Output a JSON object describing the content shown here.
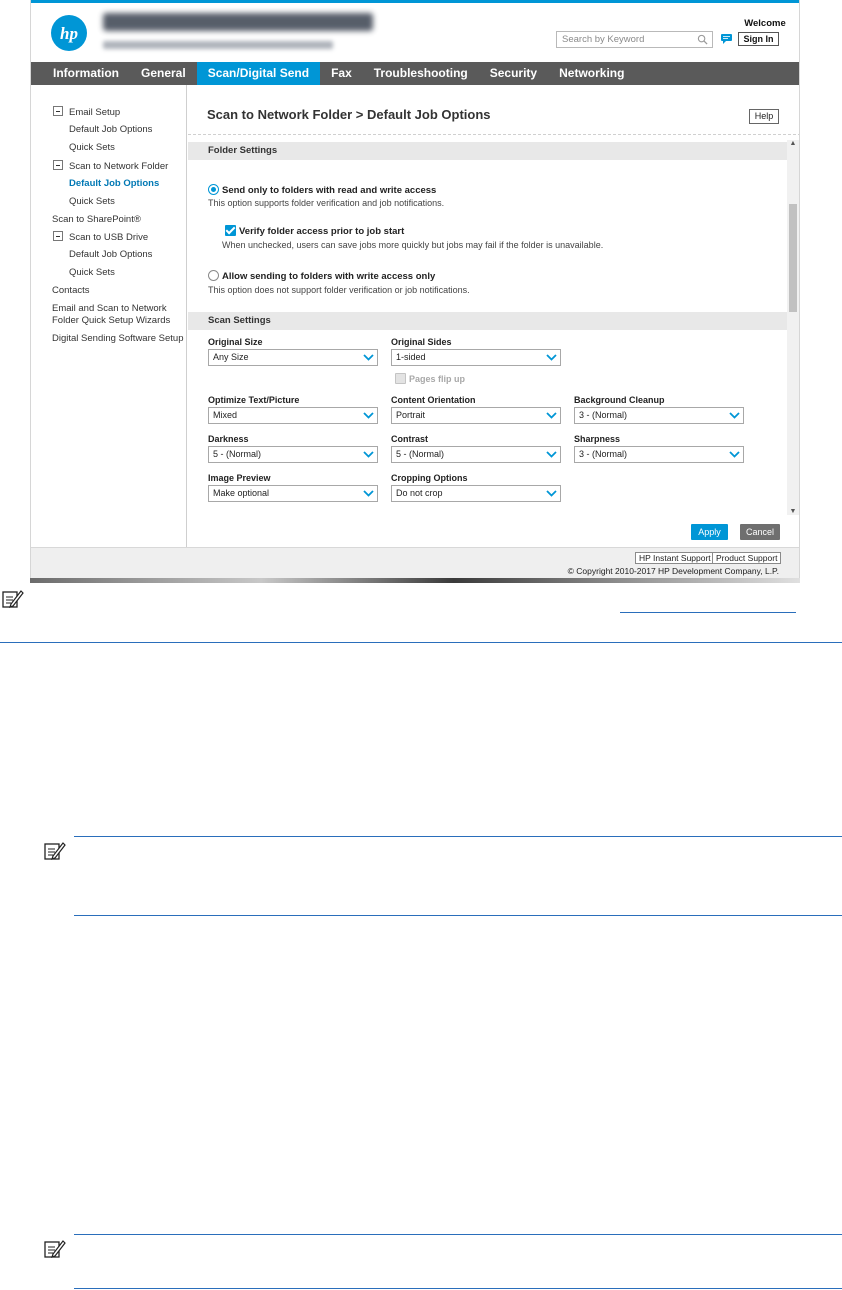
{
  "header": {
    "welcome": "Welcome",
    "sign_in": "Sign In",
    "search_placeholder": "Search by Keyword"
  },
  "nav": {
    "items": [
      "Information",
      "General",
      "Scan/Digital Send",
      "Fax",
      "Troubleshooting",
      "Security",
      "Networking"
    ],
    "active": "Scan/Digital Send"
  },
  "sidebar": {
    "email_setup": "Email Setup",
    "email_default_job_options": "Default Job Options",
    "email_quick_sets": "Quick Sets",
    "scan_to_network_folder": "Scan to Network Folder",
    "snf_default_job_options": "Default Job Options",
    "snf_quick_sets": "Quick Sets",
    "scan_to_sharepoint": "Scan to SharePoint®",
    "scan_to_usb_drive": "Scan to USB Drive",
    "usb_default_job_options": "Default Job Options",
    "usb_quick_sets": "Quick Sets",
    "contacts": "Contacts",
    "wizards_line1": "Email and Scan to Network",
    "wizards_line2": "Folder Quick Setup Wizards",
    "digital_sending_software_setup": "Digital Sending Software Setup"
  },
  "main": {
    "title": "Scan to Network Folder > Default Job Options",
    "help": "Help",
    "folder_settings": {
      "heading": "Folder Settings",
      "option_rw_label": "Send only to folders with read and write access",
      "option_rw_desc": "This option supports folder verification and job notifications.",
      "verify_label": "Verify folder access prior to job start",
      "verify_desc": "When unchecked, users can save jobs more quickly but jobs may fail if the folder is unavailable.",
      "option_w_label": "Allow sending to folders with write access only",
      "option_w_desc": "This option does not support folder verification or job notifications."
    },
    "scan_settings": {
      "heading": "Scan Settings",
      "original_size_label": "Original Size",
      "original_size_value": "Any Size",
      "original_sides_label": "Original Sides",
      "original_sides_value": "1-sided",
      "pages_flip_up": "Pages flip up",
      "optimize_label": "Optimize Text/Picture",
      "optimize_value": "Mixed",
      "orientation_label": "Content Orientation",
      "orientation_value": "Portrait",
      "bg_cleanup_label": "Background Cleanup",
      "bg_cleanup_value": "3 - (Normal)",
      "darkness_label": "Darkness",
      "darkness_value": "5 - (Normal)",
      "contrast_label": "Contrast",
      "contrast_value": "5 - (Normal)",
      "sharpness_label": "Sharpness",
      "sharpness_value": "3 - (Normal)",
      "image_preview_label": "Image Preview",
      "image_preview_value": "Make optional",
      "cropping_label": "Cropping Options",
      "cropping_value": "Do not crop"
    },
    "apply": "Apply",
    "cancel": "Cancel"
  },
  "footer": {
    "instant_support": "HP Instant Support",
    "product_support": "Product Support",
    "copyright": "© Copyright 2010-2017 HP Development Company, L.P."
  },
  "colors": {
    "accent": "#0096d6",
    "nav_bg": "#5a5a5a",
    "note_rule": "#2a6ebb"
  }
}
